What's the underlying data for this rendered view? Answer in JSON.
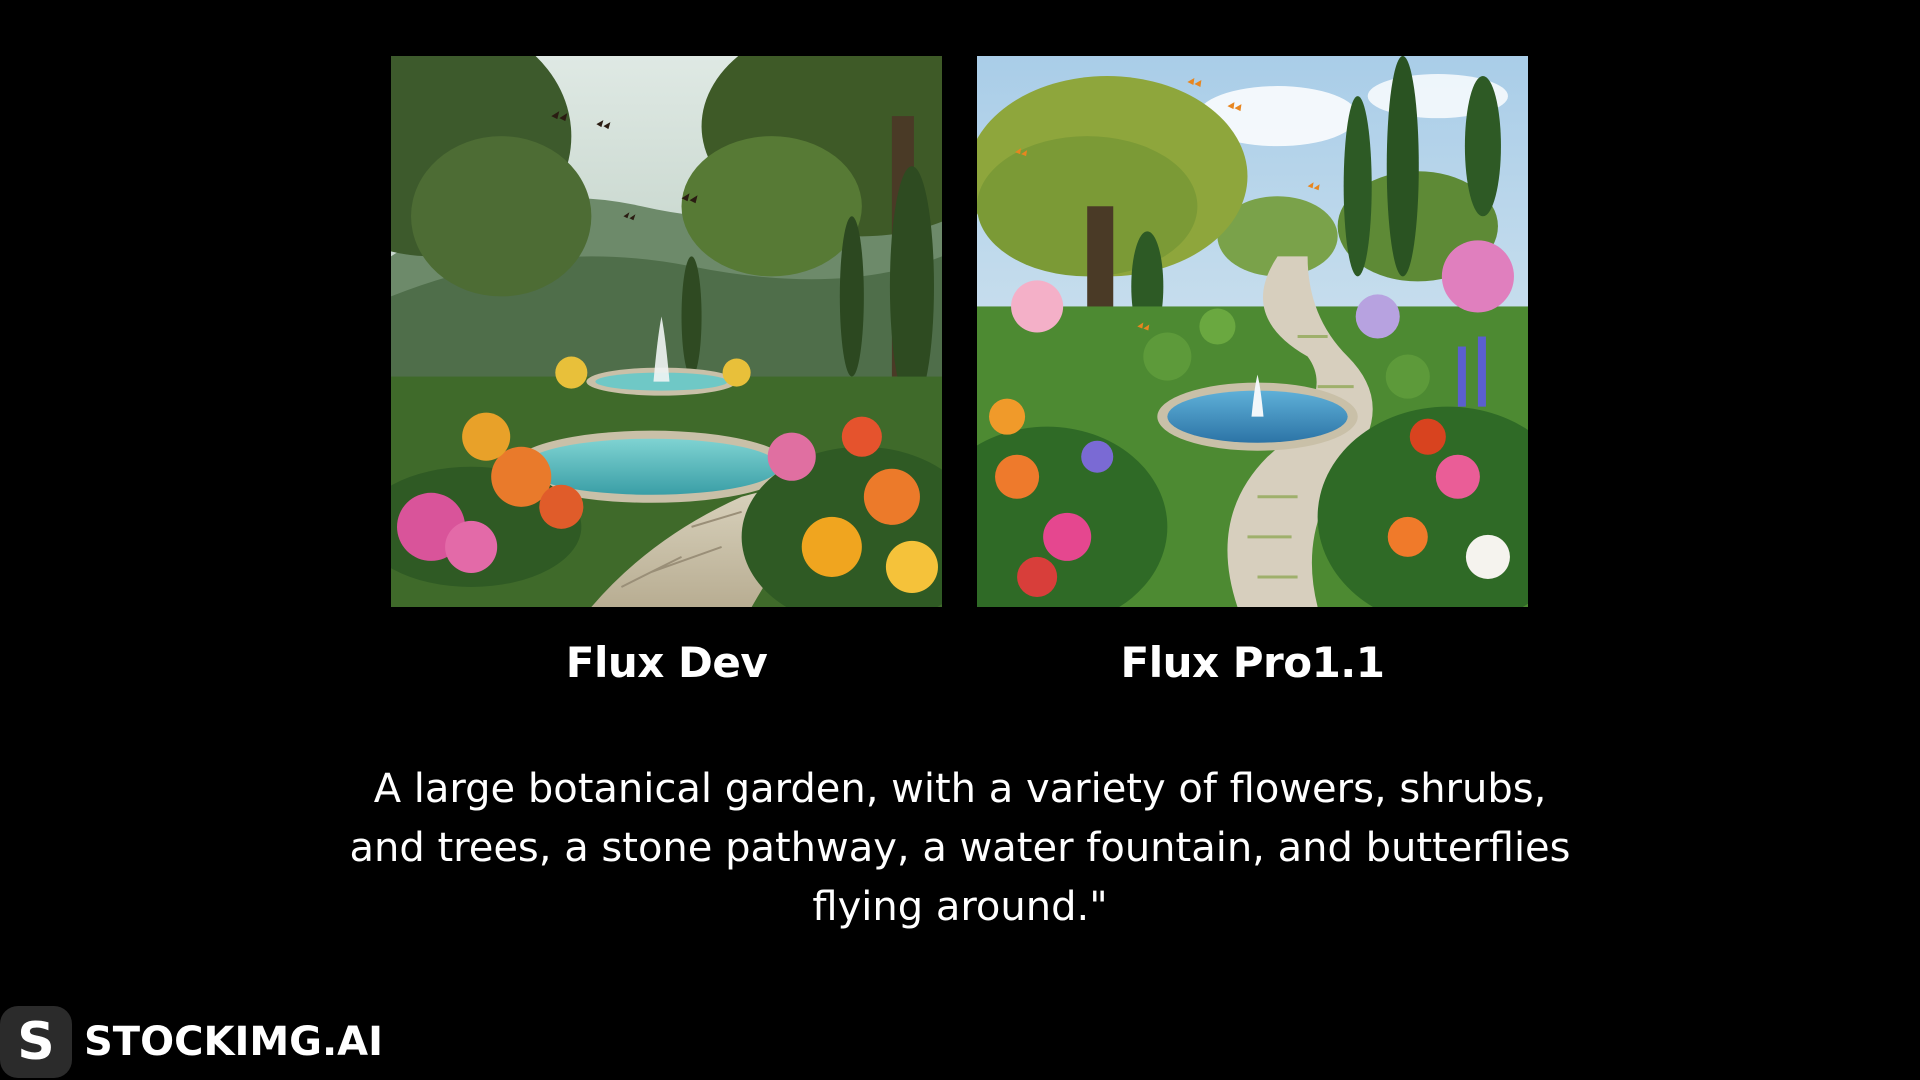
{
  "comparison": {
    "left": {
      "caption": "Flux Dev",
      "image": "garden-image-flux-dev"
    },
    "right": {
      "caption": "Flux Pro1.1",
      "image": "garden-image-flux-pro"
    }
  },
  "prompt": {
    "line1": "A large botanical garden, with a variety of flowers, shrubs,",
    "line2": "and trees, a stone pathway, a water fountain, and butterflies",
    "line3": "flying around.\""
  },
  "brand": {
    "logo_letter": "S",
    "name": "STOCKIMG.AI"
  },
  "colors": {
    "background": "#000000",
    "text": "#ffffff",
    "logo_bg": "#2b2b2b"
  }
}
